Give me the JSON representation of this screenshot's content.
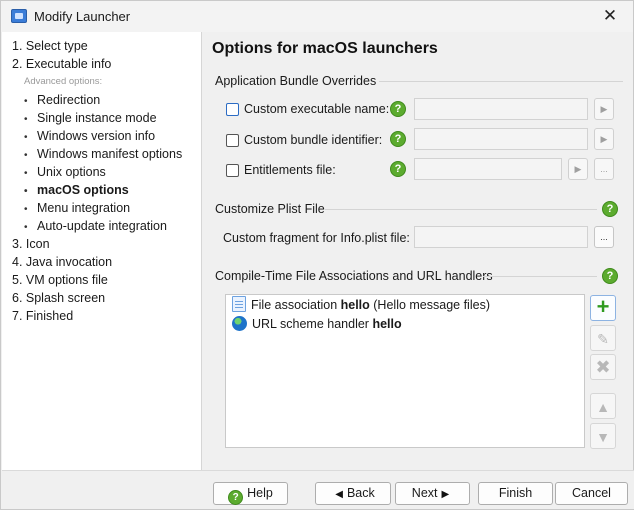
{
  "window": {
    "title": "Modify Launcher",
    "close_symbol": "✕"
  },
  "sidebar": {
    "items": [
      {
        "label": "1. Select type",
        "kind": "top"
      },
      {
        "label": "2. Executable info",
        "kind": "top"
      },
      {
        "label": "Advanced options:",
        "kind": "caption"
      },
      {
        "label": "Redirection",
        "kind": "sub"
      },
      {
        "label": "Single instance mode",
        "kind": "sub"
      },
      {
        "label": "Windows version info",
        "kind": "sub"
      },
      {
        "label": "Windows manifest options",
        "kind": "sub"
      },
      {
        "label": "Unix options",
        "kind": "sub"
      },
      {
        "label": "macOS options",
        "kind": "sub",
        "active": true
      },
      {
        "label": "Menu integration",
        "kind": "sub"
      },
      {
        "label": "Auto-update integration",
        "kind": "sub"
      },
      {
        "label": "3. Icon",
        "kind": "top"
      },
      {
        "label": "4. Java invocation",
        "kind": "top"
      },
      {
        "label": "5. VM options file",
        "kind": "top"
      },
      {
        "label": "6. Splash screen",
        "kind": "top"
      },
      {
        "label": "7. Finished",
        "kind": "top"
      }
    ]
  },
  "main": {
    "heading": "Options for macOS launchers",
    "bundle_section": {
      "title": "Application Bundle Overrides",
      "fields": [
        {
          "label": "Custom executable name:",
          "checked": false,
          "value": ""
        },
        {
          "label": "Custom bundle identifier:",
          "checked": false,
          "value": ""
        },
        {
          "label": "Entitlements file:",
          "checked": false,
          "value": ""
        }
      ]
    },
    "plist_section": {
      "title": "Customize Plist File",
      "fragment_label": "Custom fragment for Info.plist file:",
      "fragment_value": ""
    },
    "assoc_section": {
      "title": "Compile-Time File Associations and URL handlers",
      "items": [
        {
          "prefix": "File association ",
          "name": "hello",
          "suffix": " (Hello message files)",
          "icon": "document-icon"
        },
        {
          "prefix": "URL scheme handler ",
          "name": "hello",
          "suffix": "",
          "icon": "globe-icon"
        }
      ]
    },
    "help_symbol": "?",
    "browse_symbol": "...",
    "arrow_symbol": "▶"
  },
  "footer": {
    "help_label": "Help",
    "back_label": "Back",
    "next_label": "Next",
    "finish_label": "Finish",
    "cancel_label": "Cancel"
  },
  "colors": {
    "help_green": "#5cab2f",
    "add_green": "#2f9a1f",
    "focus_blue": "#2c6cc4"
  }
}
